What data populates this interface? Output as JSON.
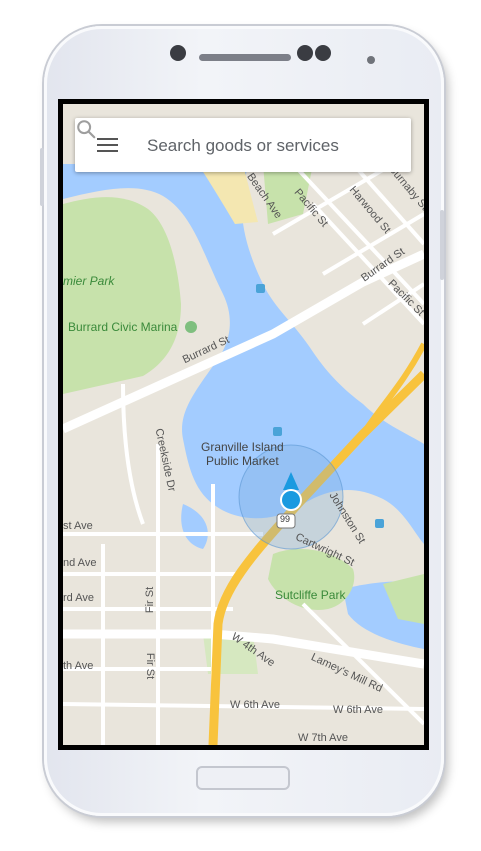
{
  "search": {
    "placeholder": "Search goods or services"
  },
  "icons": {
    "menu": "menu-icon",
    "search": "search-icon",
    "location": "my-location-icon"
  },
  "colors": {
    "water": "#a3ccff",
    "park": "#c7e2ab",
    "land": "#e9e5dc",
    "highway": "#f8c33d",
    "location": "#1a9ae0"
  },
  "map": {
    "labels": {
      "pacific_st_top": "Pacific St",
      "beach_ave": "Beach Ave",
      "harwood_st": "Harwood St",
      "burnaby_st": "Burnaby St",
      "burrard_st_right": "Burrard St",
      "pacific_st_right": "Pacific St",
      "park_partial": "mier Park",
      "marina": "Burrard Civic Marina",
      "burrard_st": "Burrard St",
      "creekside_dr": "Creekside Dr",
      "market": "Granville Island Public Market",
      "johnston_st": "Johnston St",
      "route_badge": "99",
      "cartwright_st": "Cartwright St",
      "st_ave_1": "st Ave",
      "nd_ave": "nd Ave",
      "rd_ave": "rd Ave",
      "fir_st_upper": "Fir St",
      "sutcliffe_park": "Sutcliffe Park",
      "fir_st": "Fir St",
      "w_4th_ave": "W 4th Ave",
      "lameys_mill_rd": "Lamey's Mill Rd",
      "th_ave": "th Ave",
      "w_6th_ave_left": "W 6th Ave",
      "w_6th_ave_right": "W 6th Ave",
      "w_7th_ave": "W 7th Ave"
    }
  }
}
